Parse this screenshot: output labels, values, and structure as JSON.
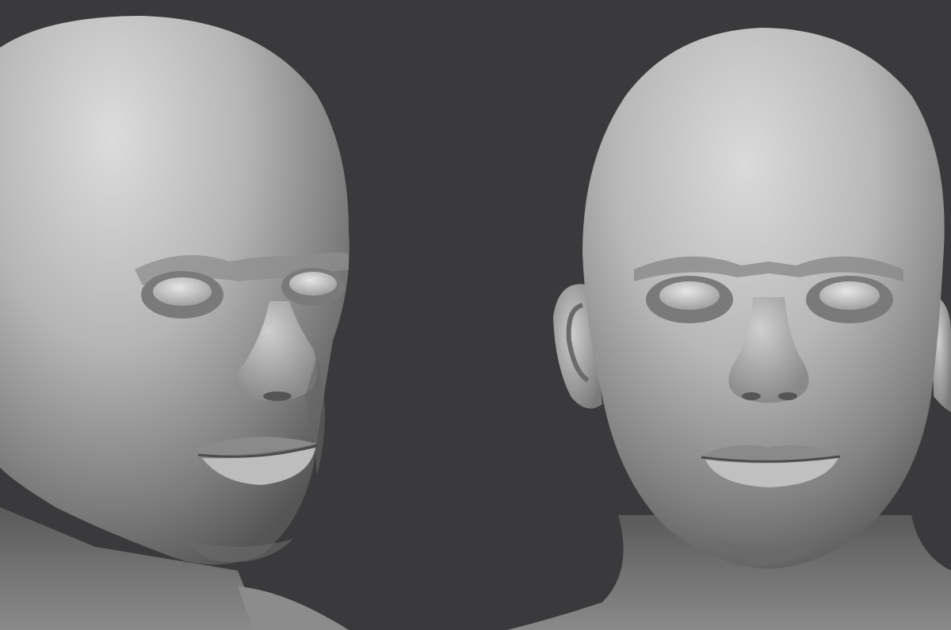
{
  "scene": {
    "background_color": "#3a3a3c",
    "clay_light": "#d2d2d2",
    "clay_mid": "#9c9c9c",
    "clay_shadow": "#4a4a4a",
    "models": [
      {
        "view": "three-quarter-right"
      },
      {
        "view": "front"
      }
    ]
  }
}
